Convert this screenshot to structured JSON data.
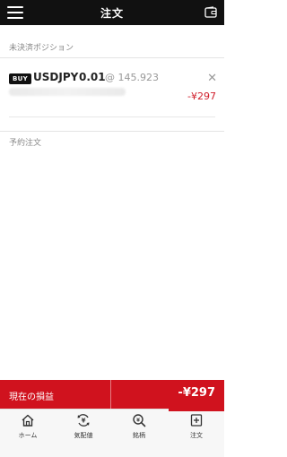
{
  "header": {
    "title": "注文"
  },
  "positions": {
    "section_label": "未決済ポジション",
    "items": [
      {
        "side": "BUY",
        "symbol": "USDJPY",
        "lot": "0.01",
        "rate": "@ 145.923",
        "pnl": "-¥297"
      }
    ]
  },
  "orders": {
    "section_label": "予約注文"
  },
  "summary": {
    "label": "現在の損益",
    "value": "-¥297"
  },
  "tabs": [
    {
      "label": "ホーム",
      "icon": "home-icon"
    },
    {
      "label": "気配値",
      "icon": "yen-refresh-icon"
    },
    {
      "label": "銘柄",
      "icon": "search-icon"
    },
    {
      "label": "注文",
      "icon": "order-icon",
      "active": true
    }
  ],
  "colors": {
    "accent": "#d0121e",
    "header_bg": "#111111",
    "loss": "#d01e2b"
  }
}
